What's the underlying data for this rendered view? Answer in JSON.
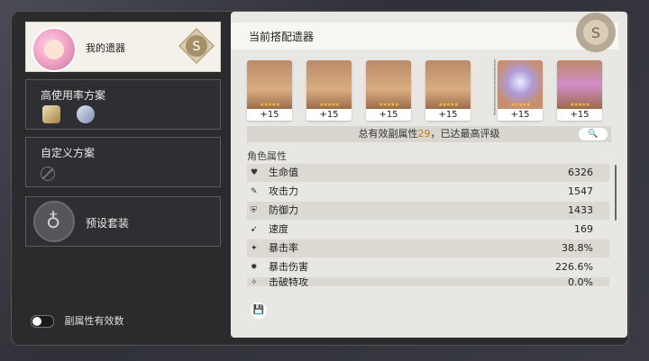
{
  "left": {
    "my_relics_label": "我的遗器",
    "high_use_label": "高使用率方案",
    "custom_label": "自定义方案",
    "preset_label": "预设套装",
    "toggle_label": "副属性有效数",
    "rating": "S"
  },
  "panel": {
    "title": "当前搭配遗器",
    "rating": "S",
    "relics": [
      {
        "level": "+15",
        "stars": 5,
        "kind": "headgear"
      },
      {
        "level": "+15",
        "stars": 5,
        "kind": "gloves"
      },
      {
        "level": "+15",
        "stars": 5,
        "kind": "armor"
      },
      {
        "level": "+15",
        "stars": 5,
        "kind": "boots"
      },
      {
        "level": "+15",
        "stars": 5,
        "kind": "sphere"
      },
      {
        "level": "+15",
        "stars": 5,
        "kind": "rope"
      }
    ],
    "summary_prefix": "总有效副属性",
    "summary_count": "29",
    "summary_suffix": "，已达最高评级",
    "search_icon": "🔍",
    "attr_title": "角色属性",
    "attributes": [
      {
        "name": "生命值",
        "value": "6326",
        "icon": "♥"
      },
      {
        "name": "攻击力",
        "value": "1547",
        "icon": "✎"
      },
      {
        "name": "防御力",
        "value": "1433",
        "icon": "⛨"
      },
      {
        "name": "速度",
        "value": "169",
        "icon": "➹"
      },
      {
        "name": "暴击率",
        "value": "38.8%",
        "icon": "✦"
      },
      {
        "name": "暴击伤害",
        "value": "226.6%",
        "icon": "✹"
      },
      {
        "name": "击破特攻",
        "value": "0.0%",
        "icon": "✧"
      }
    ],
    "save_icon": "💾"
  }
}
